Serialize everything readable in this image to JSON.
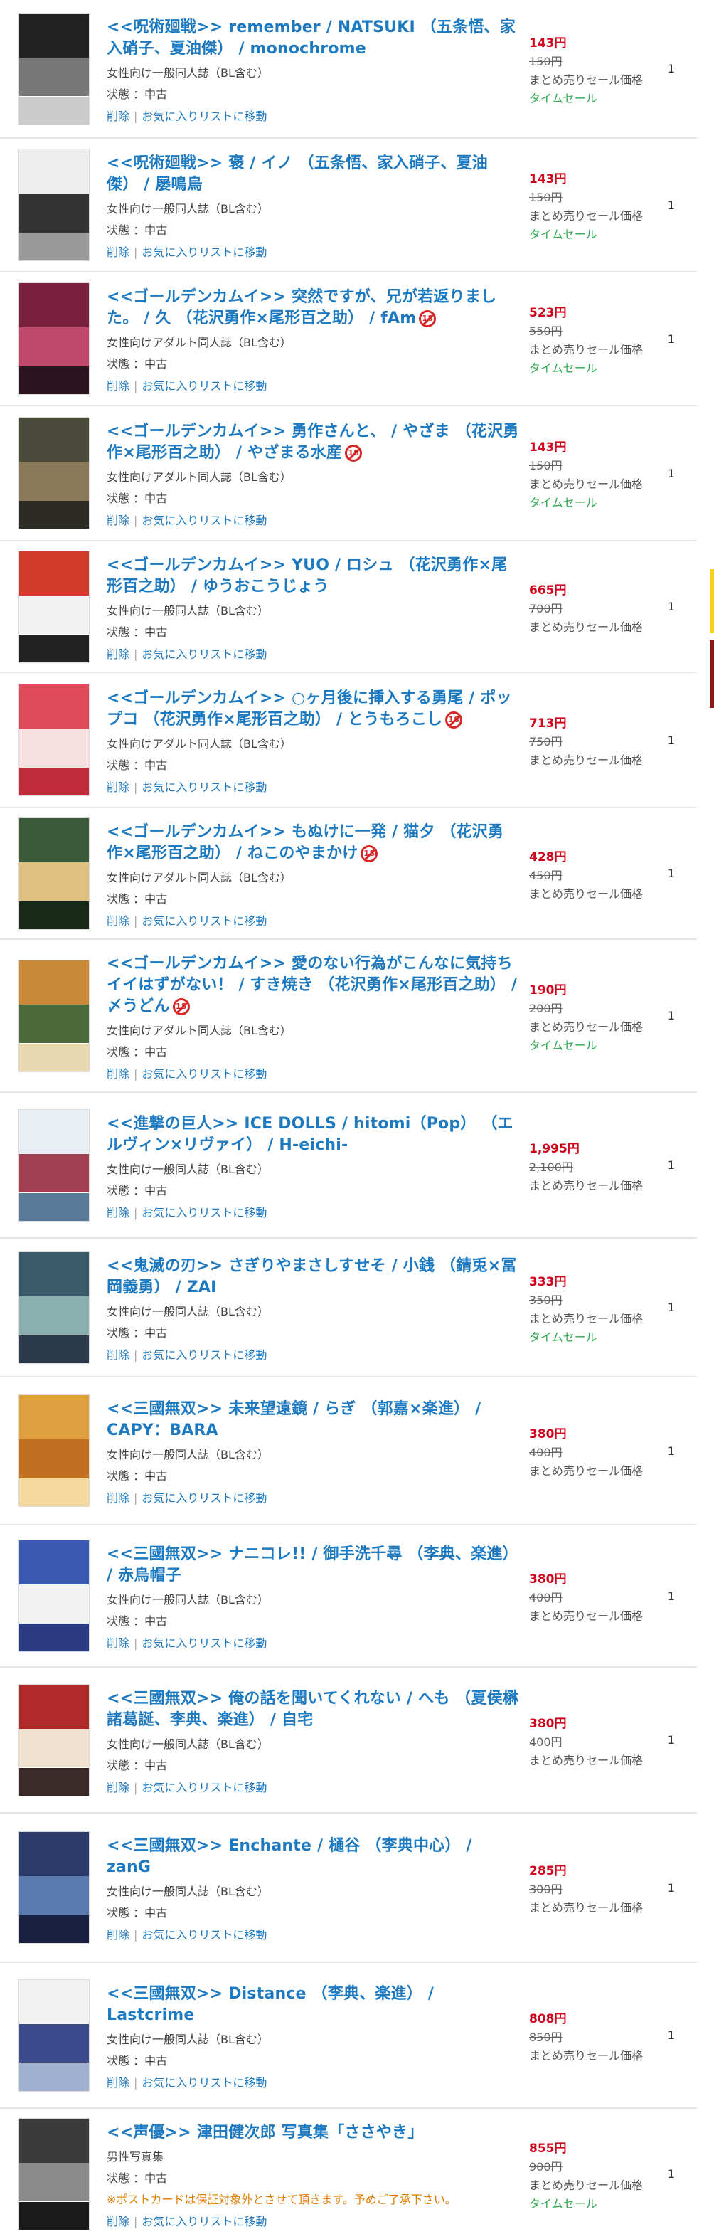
{
  "labels": {
    "delete": "削除",
    "favorite": "お気に入りリストに移動",
    "separator": "|",
    "set_sale": "まとめ売りセール価格",
    "time_sale": "タイムセール"
  },
  "items": [
    {
      "title": "<<呪術廻戦>> remember / NATSUKI （五条悟、家入硝子、夏油傑） / monochrome",
      "r18": false,
      "category": "女性向け一般同人誌（BL含む）",
      "condition": "状態 ：中古",
      "price": "143円",
      "old_price": "150円",
      "time_sale": true,
      "qty": "1",
      "colors": [
        "#222",
        "#777",
        "#ccc"
      ]
    },
    {
      "title": "<<呪術廻戦>> 褒 / イノ （五条悟、家入硝子、夏油傑） / 屡鳴烏",
      "r18": false,
      "category": "女性向け一般同人誌（BL含む）",
      "condition": "状態 ：中古",
      "price": "143円",
      "old_price": "150円",
      "time_sale": true,
      "qty": "1",
      "colors": [
        "#eee",
        "#333",
        "#999"
      ]
    },
    {
      "title": "<<ゴールデンカムイ>> 突然ですが、兄が若返りました。 / 久 （花沢勇作×尾形百之助） / fAm",
      "r18": true,
      "category": "女性向けアダルト同人誌（BL含む）",
      "condition": "状態 ：中古",
      "price": "523円",
      "old_price": "550円",
      "time_sale": true,
      "qty": "1",
      "colors": [
        "#7a1f3d",
        "#c04a6e",
        "#2b1420"
      ]
    },
    {
      "title": "<<ゴールデンカムイ>> 勇作さんと、 / やざま （花沢勇作×尾形百之助） / やざまる水産",
      "r18": true,
      "category": "女性向けアダルト同人誌（BL含む）",
      "condition": "状態 ：中古",
      "price": "143円",
      "old_price": "150円",
      "time_sale": true,
      "qty": "1",
      "colors": [
        "#4a4a3a",
        "#8a7a5a",
        "#2c2c24"
      ]
    },
    {
      "title": "<<ゴールデンカムイ>> YUO / ロシュ （花沢勇作×尾形百之助） / ゆうおこうじょう",
      "r18": false,
      "category": "女性向け一般同人誌（BL含む）",
      "condition": "状態 ：中古",
      "price": "665円",
      "old_price": "700円",
      "time_sale": false,
      "qty": "1",
      "colors": [
        "#d23b2a",
        "#f2f2f2",
        "#222"
      ]
    },
    {
      "title": "<<ゴールデンカムイ>> ○ヶ月後に挿入する勇尾 / ポップコ （花沢勇作×尾形百之助） / とうもろこし",
      "r18": true,
      "category": "女性向けアダルト同人誌（BL含む）",
      "condition": "状態 ：中古",
      "price": "713円",
      "old_price": "750円",
      "time_sale": false,
      "qty": "1",
      "colors": [
        "#e04a5a",
        "#f6e0e0",
        "#c02a3a"
      ]
    },
    {
      "title": "<<ゴールデンカムイ>> もぬけに一発 / 猫夕 （花沢勇作×尾形百之助） / ねこのやまかけ",
      "r18": true,
      "category": "女性向けアダルト同人誌（BL含む）",
      "condition": "状態 ：中古",
      "price": "428円",
      "old_price": "450円",
      "time_sale": false,
      "qty": "1",
      "colors": [
        "#3a5a3a",
        "#e0c080",
        "#1a2a1a"
      ]
    },
    {
      "title": "<<ゴールデンカムイ>> 愛のない行為がこんなに気持ちイイはずがない！ / すき焼き （花沢勇作×尾形百之助） / 〆うどん",
      "r18": true,
      "category": "女性向けアダルト同人誌（BL含む）",
      "condition": "状態 ：中古",
      "price": "190円",
      "old_price": "200円",
      "time_sale": true,
      "qty": "1",
      "colors": [
        "#c88a3a",
        "#4a6a3a",
        "#e8d8b0"
      ]
    },
    {
      "title": "<<進撃の巨人>> ICE DOLLS / hitomi（Pop） （エルヴィン×リヴァイ） / H-eichi-",
      "r18": false,
      "category": "女性向け一般同人誌（BL含む）",
      "condition": "状態 ：中古",
      "price": "1,995円",
      "old_price": "2,100円",
      "time_sale": false,
      "qty": "1",
      "colors": [
        "#e8f0f6",
        "#a04050",
        "#5a7a9a"
      ]
    },
    {
      "title": "<<鬼滅の刃>> さぎりやまさしすせそ / 小銭 （錆兎×冨岡義勇） / ZAI",
      "r18": false,
      "category": "女性向け一般同人誌（BL含む）",
      "condition": "状態 ：中古",
      "price": "333円",
      "old_price": "350円",
      "time_sale": true,
      "qty": "1",
      "colors": [
        "#3a5a6a",
        "#8ab0b0",
        "#2a3a4a"
      ]
    },
    {
      "title": "<<三國無双>> 未来望遠鏡 / らぎ （郭嘉×楽進） / CAPY：BARA",
      "r18": false,
      "category": "女性向け一般同人誌（BL含む）",
      "condition": "状態 ：中古",
      "price": "380円",
      "old_price": "400円",
      "time_sale": false,
      "qty": "1",
      "colors": [
        "#e0a040",
        "#c07020",
        "#f4d8a0"
      ]
    },
    {
      "title": "<<三國無双>> ナニコレ!! / 御手洗千尋 （李典、楽進） / 赤烏帽子",
      "r18": false,
      "category": "女性向け一般同人誌（BL含む）",
      "condition": "状態 ：中古",
      "price": "380円",
      "old_price": "400円",
      "time_sale": false,
      "qty": "1",
      "colors": [
        "#3a5ab0",
        "#f2f2f2",
        "#2a3a80"
      ]
    },
    {
      "title": "<<三國無双>> 俺の話を聞いてくれない / へも （夏侯楙 諸葛誕、李典、楽進） / 自宅",
      "r18": false,
      "category": "女性向け一般同人誌（BL含む）",
      "condition": "状態 ：中古",
      "price": "380円",
      "old_price": "400円",
      "time_sale": false,
      "qty": "1",
      "colors": [
        "#b02a2a",
        "#f0e0d0",
        "#3a2a2a"
      ]
    },
    {
      "title": "<<三國無双>> Enchante / 樋谷 （李典中心） / zanG",
      "r18": false,
      "category": "女性向け一般同人誌（BL含む）",
      "condition": "状態 ：中古",
      "price": "285円",
      "old_price": "300円",
      "time_sale": false,
      "qty": "1",
      "colors": [
        "#2a3a6a",
        "#5a7ab0",
        "#1a2040"
      ]
    },
    {
      "title": "<<三國無双>> Distance （李典、楽進） / Lastcrime",
      "r18": false,
      "category": "女性向け一般同人誌（BL含む）",
      "condition": "状態 ：中古",
      "price": "808円",
      "old_price": "850円",
      "time_sale": false,
      "qty": "1",
      "colors": [
        "#f2f2f2",
        "#3a4a8a",
        "#a0b0d0"
      ]
    },
    {
      "title": "<<声優>> 津田健次郎 写真集「ささやき」",
      "r18": false,
      "category": "男性写真集",
      "condition": "状態 ：中古",
      "notice": "※ポストカードは保証対象外とさせて頂きます。予めご了承下さい。",
      "price": "855円",
      "old_price": "900円",
      "time_sale": true,
      "qty": "1",
      "colors": [
        "#3a3a3a",
        "#8a8a8a",
        "#1a1a1a"
      ]
    }
  ],
  "scroll_colors": [
    "#f3d21a",
    "#8a1818"
  ]
}
